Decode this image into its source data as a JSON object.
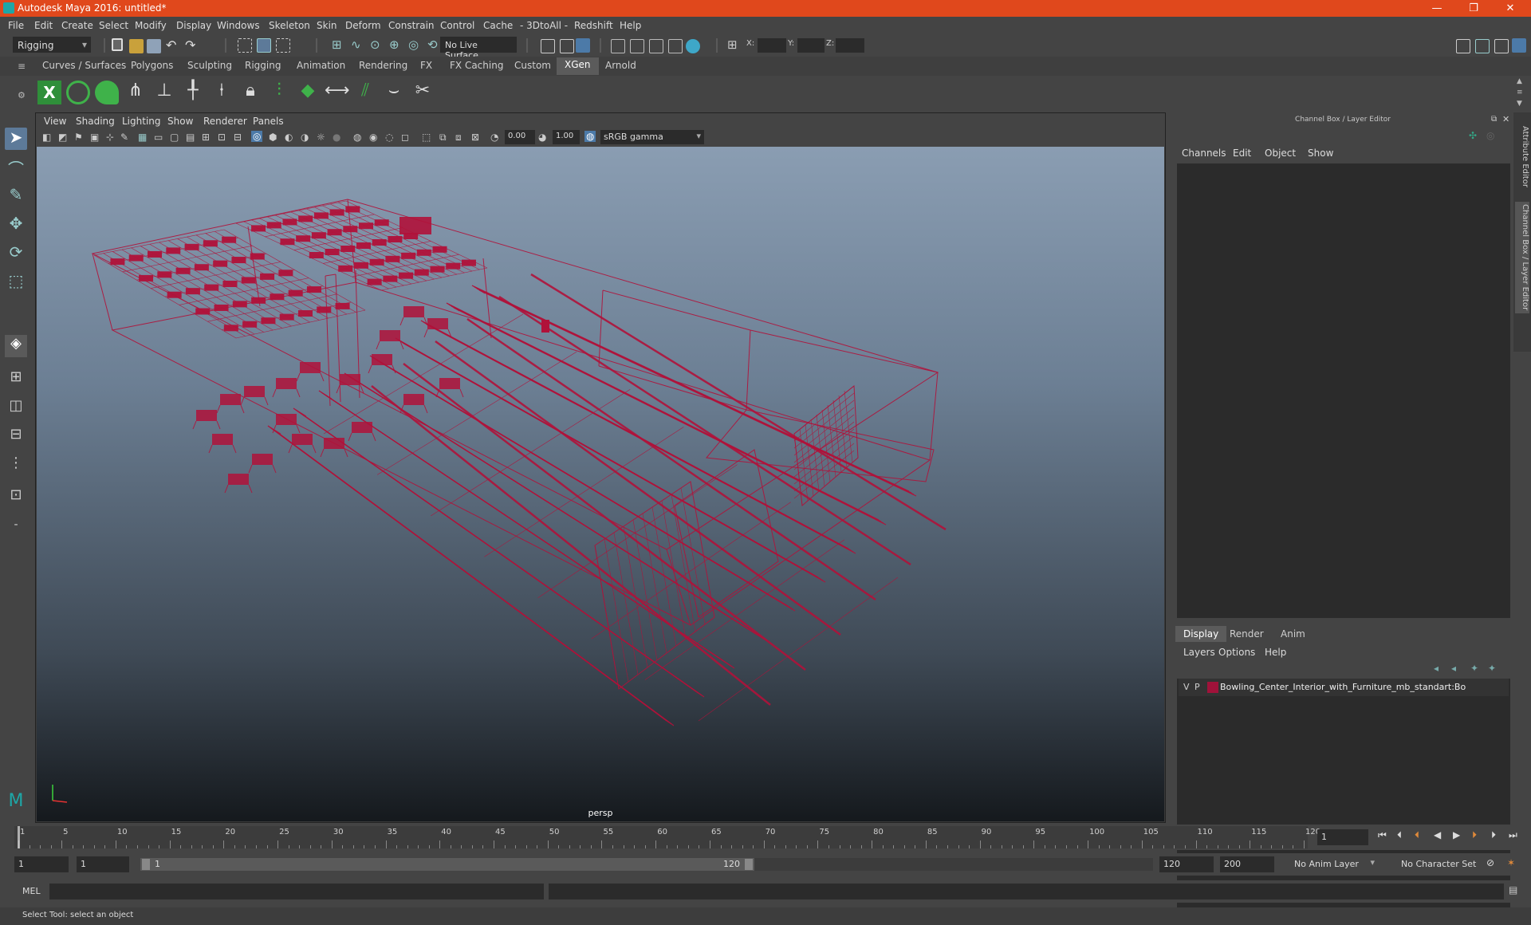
{
  "window": {
    "title": "Autodesk Maya 2016: untitled*",
    "minimize": "—",
    "maximize": "❐",
    "close": "✕"
  },
  "menu": [
    "File",
    "Edit",
    "Create",
    "Select",
    "Modify",
    "Display",
    "Windows",
    "Skeleton",
    "Skin",
    "Deform",
    "Constrain",
    "Control",
    "Cache",
    "- 3DtoAll -",
    "Redshift",
    "Help"
  ],
  "status_line": {
    "menuset": "Rigging",
    "live_surface": "No Live Surface",
    "x_label": "X:",
    "y_label": "Y:",
    "z_label": "Z:"
  },
  "shelf_tabs": [
    "Curves / Surfaces",
    "Polygons",
    "Sculpting",
    "Rigging",
    "Animation",
    "Rendering",
    "FX",
    "FX Caching",
    "Custom",
    "XGen",
    "Arnold"
  ],
  "active_shelf": "XGen",
  "viewport": {
    "menus": [
      "View",
      "Shading",
      "Lighting",
      "Show",
      "Renderer",
      "Panels"
    ],
    "exposure": "0.00",
    "gamma": "1.00",
    "colorspace": "sRGB gamma",
    "camera": "persp",
    "wire_color": "#b0123a"
  },
  "channel_box": {
    "title": "Channel Box / Layer Editor",
    "menus": [
      "Channels",
      "Edit",
      "Object",
      "Show"
    ]
  },
  "layer_editor": {
    "tabs": [
      "Display",
      "Render",
      "Anim"
    ],
    "active_tab": "Display",
    "menus": [
      "Layers",
      "Options",
      "Help"
    ],
    "layer": {
      "v": "V",
      "p": "P",
      "name": "Bowling_Center_Interior_with_Furniture_mb_standart:Bo",
      "color": "#a0123a"
    }
  },
  "side_tabs": [
    "Attribute Editor",
    "Channel Box / Layer Editor"
  ],
  "time_slider": {
    "labels": [
      "1",
      "5",
      "10",
      "15",
      "20",
      "25",
      "30",
      "35",
      "40",
      "45",
      "50",
      "55",
      "60",
      "65",
      "70",
      "75",
      "80",
      "85",
      "90",
      "95",
      "100",
      "105",
      "110",
      "115",
      "120"
    ],
    "current_frame": "1"
  },
  "range_slider": {
    "start": "1",
    "playback_start": "1",
    "range_start": "1",
    "range_end": "120",
    "playback_end": "120",
    "end": "200",
    "anim_layer": "No Anim Layer",
    "character_set": "No Character Set"
  },
  "command_line": {
    "label": "MEL"
  },
  "help_line": "Select Tool: select an object"
}
